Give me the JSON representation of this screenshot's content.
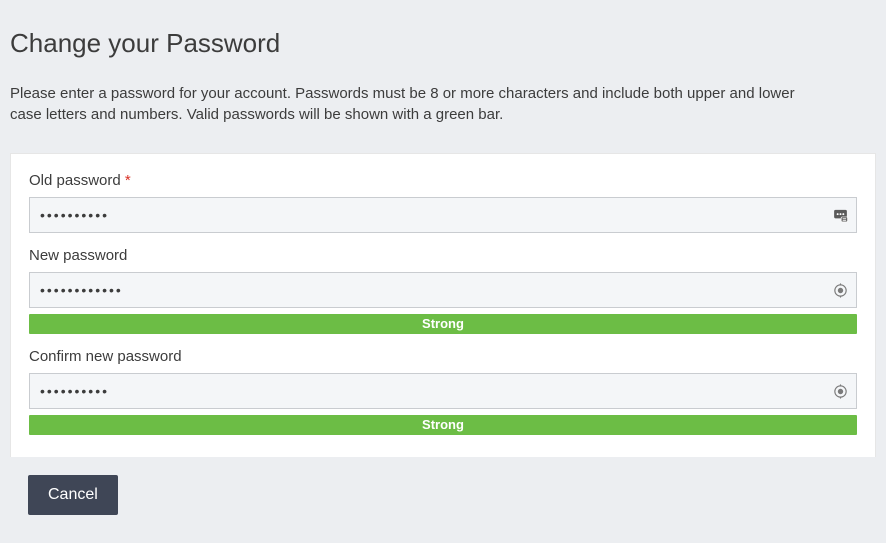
{
  "title": "Change your Password",
  "description": "Please enter a password for your account. Passwords must be 8 or more characters and include both upper and lower case letters and numbers. Valid passwords will be shown with a green bar.",
  "fields": {
    "old": {
      "label": "Old password",
      "required_marker": " *",
      "value": "••••••••••",
      "icon": "password-manager-icon"
    },
    "new": {
      "label": "New password",
      "value": "••••••••••••",
      "strength": "Strong",
      "icon": "password-toggle-icon"
    },
    "confirm": {
      "label": "Confirm new password",
      "value": "••••••••••",
      "strength": "Strong",
      "icon": "password-toggle-icon"
    }
  },
  "actions": {
    "cancel_label": "Cancel"
  },
  "colors": {
    "strength_bg": "#6cbd45",
    "page_bg": "#eceef1"
  }
}
